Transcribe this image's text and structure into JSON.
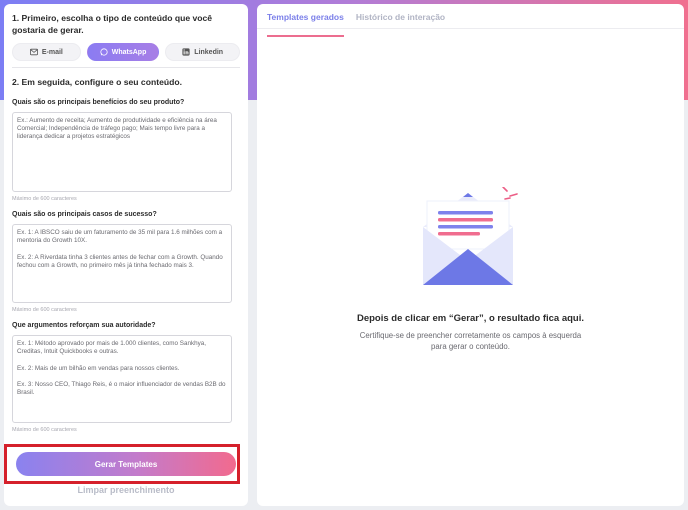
{
  "step1": {
    "title": "1. Primeiro, escolha o tipo de conteúdo que você gostaria de gerar.",
    "types": [
      {
        "label": "E-mail",
        "icon": "mail-icon",
        "active": false
      },
      {
        "label": "WhatsApp",
        "icon": "whatsapp-icon",
        "active": true
      },
      {
        "label": "Linkedin",
        "icon": "linkedin-icon",
        "active": false
      }
    ]
  },
  "step2": {
    "title": "2. Em seguida, configure o seu conteúdo.",
    "questions": [
      {
        "label": "Quais são os principais benefícios do seu produto?",
        "placeholder": "Ex.: Aumento de receita; Aumento de produtividade e eficiência na área Comercial; Independência de tráfego pago; Mais tempo livre para a liderança dedicar a projetos estratégicos",
        "helper": "Máximo de 600 caracteres"
      },
      {
        "label": "Quais são os principais casos de sucesso?",
        "placeholder": "Ex. 1: A IBSCO saiu de um faturamento de 35 mil para 1.6 milhões com a mentoria do Growth 10X.\n\nEx. 2: A Riverdata tinha 3 clientes antes de fechar com a Growth. Quando fechou com a Growth, no primeiro mês já tinha fechado mais 3.",
        "helper": "Máximo de 600 caracteres"
      },
      {
        "label": "Que argumentos reforçam sua autoridade?",
        "placeholder": "Ex. 1: Método aprovado por mais de 1.000 clientes, como Sankhya, Creditas, Intuit Quickbooks e outras.\n\nEx. 2: Mais de um bilhão em vendas para nossos clientes.\n\nEx. 3: Nosso CEO, Thiago Reis, é o maior influenciador de vendas B2B do Brasil.",
        "helper": "Máximo de 600 caracteres"
      }
    ]
  },
  "actions": {
    "generate_label": "Gerar Templates",
    "clear_label": "Limpar preenchimento"
  },
  "right": {
    "tabs": [
      {
        "label": "Templates gerados",
        "active": true
      },
      {
        "label": "Histórico de interação",
        "active": false
      }
    ],
    "empty_title": "Depois de clicar em “Gerar”, o resultado fica aqui.",
    "empty_subtitle": "Certifique-se de preencher corretamente os campos à esquerda para gerar o conteúdo."
  },
  "colors": {
    "accent_purple": "#7b7fe9",
    "accent_pink": "#ec6d8f",
    "highlight_red": "#d5202b"
  }
}
